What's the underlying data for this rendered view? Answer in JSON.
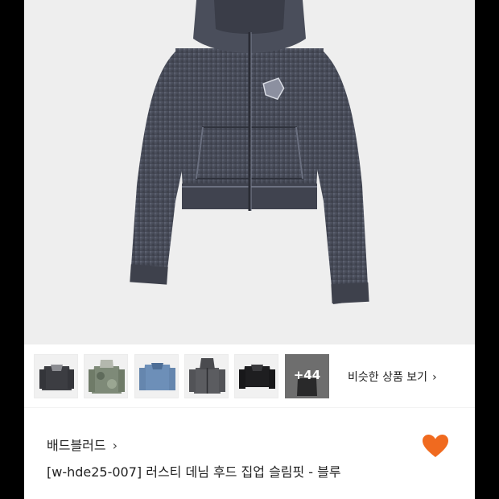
{
  "product": {
    "brand": "배드블러드",
    "brand_chevron": "›",
    "title": "[w-hde25-007] 러스티 데님 후드 집업 슬림핏 - 블루",
    "liked": true,
    "heart_color": "#f06a1f"
  },
  "thumbnails": {
    "items": [
      {
        "icon": "jacket-dark-collared-icon"
      },
      {
        "icon": "jacket-camo-hooded-icon"
      },
      {
        "icon": "jacket-denim-icon"
      },
      {
        "icon": "hoodie-gray-zip-icon"
      },
      {
        "icon": "jacket-black-leather-icon"
      }
    ],
    "more_label": "+44",
    "similar_label": "비슷한 상품 보기",
    "similar_chevron": "›"
  }
}
